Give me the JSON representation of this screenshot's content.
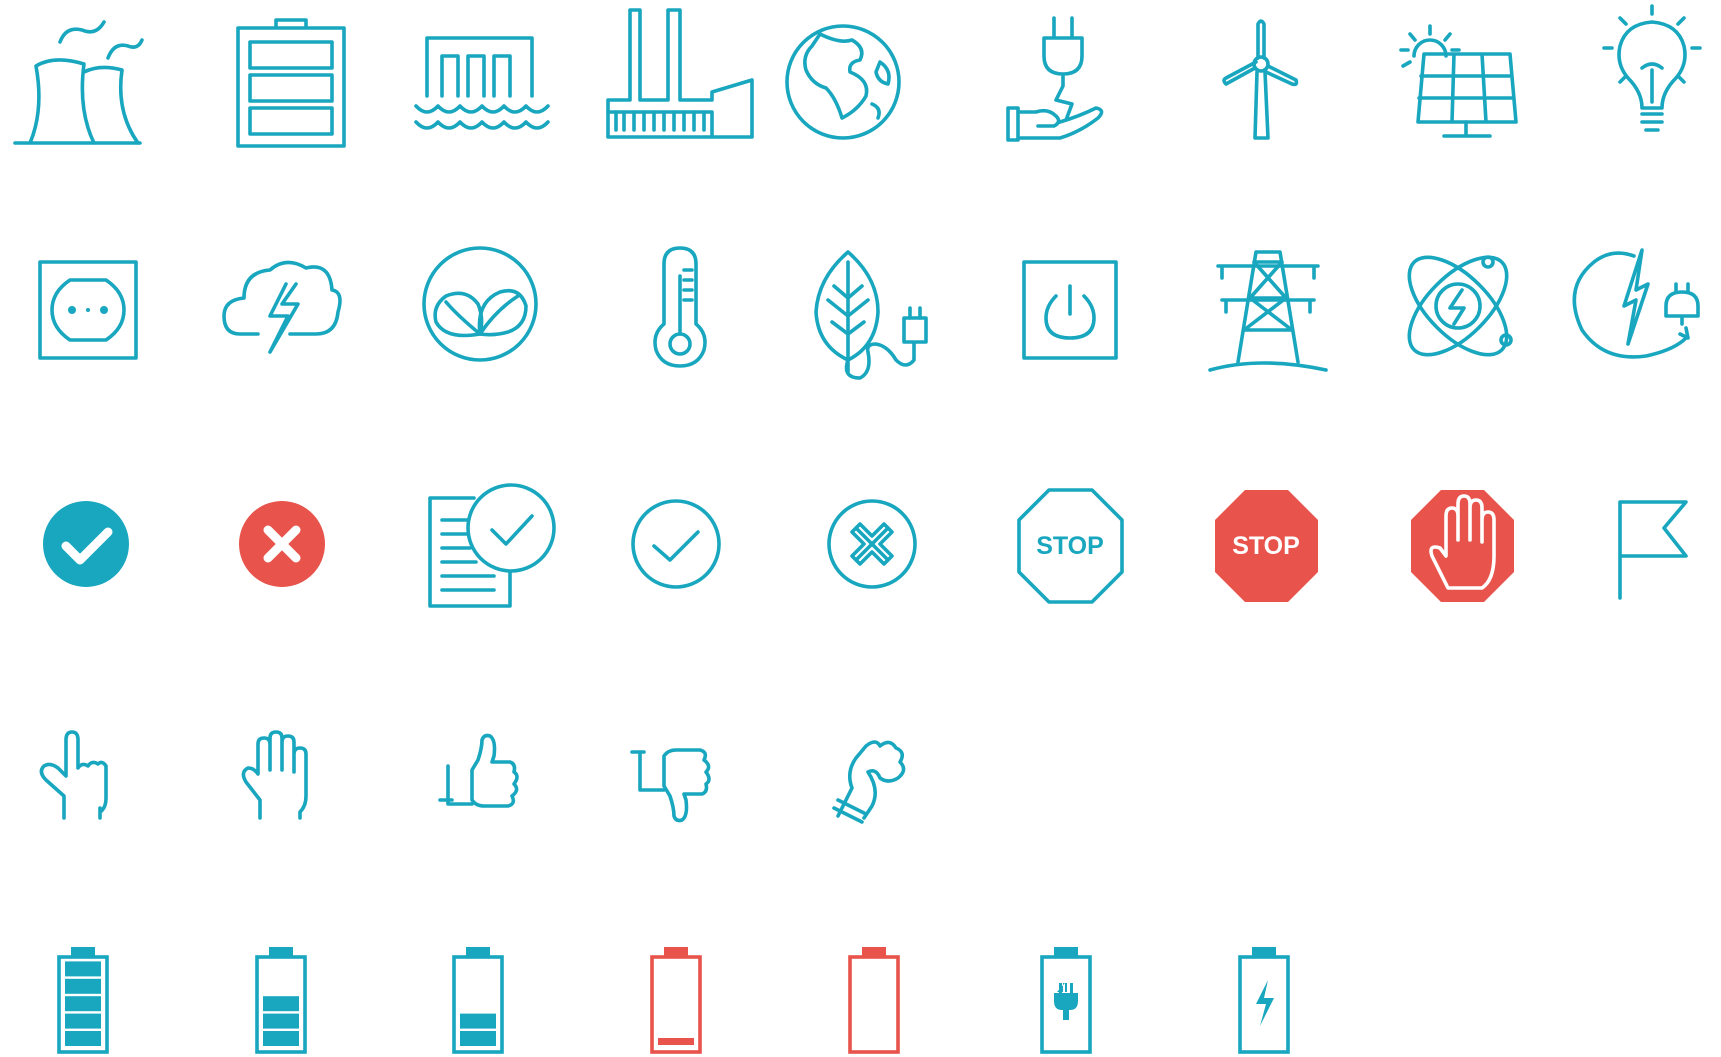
{
  "colors": {
    "teal": "#19a7bf",
    "red": "#e8534b",
    "white": "#ffffff"
  },
  "icons": [
    "nuclear-plant-icon",
    "battery-full-icon",
    "hydro-dam-icon",
    "factory-icon",
    "globe-icon",
    "plug-hand-icon",
    "wind-turbine-icon",
    "solar-panel-icon",
    "light-bulb-icon",
    "wall-socket-icon",
    "storm-cloud-icon",
    "eco-leaves-icon",
    "thermometer-icon",
    "leaf-plug-icon",
    "power-button-icon",
    "power-tower-icon",
    "atom-energy-icon",
    "renewable-energy-icon",
    "check-circle-filled-icon",
    "x-circle-filled-icon",
    "document-check-icon",
    "check-circle-outline-icon",
    "x-circle-outline-icon",
    "stop-sign-outline-icon",
    "stop-sign-filled-icon",
    "stop-hand-sign-icon",
    "flag-icon",
    "pointing-hand-icon",
    "raised-hand-icon",
    "thumbs-up-icon",
    "thumbs-down-icon",
    "ok-hand-icon",
    "battery-5-bars-icon",
    "battery-3-bars-icon",
    "battery-2-bars-icon",
    "battery-low-icon",
    "battery-empty-icon",
    "battery-plug-icon",
    "battery-charging-icon"
  ],
  "signs": {
    "stop_outline_text": "STOP",
    "stop_filled_text": "STOP"
  },
  "battery_levels": [
    1.0,
    0.6,
    0.4,
    0.1,
    0.0
  ]
}
